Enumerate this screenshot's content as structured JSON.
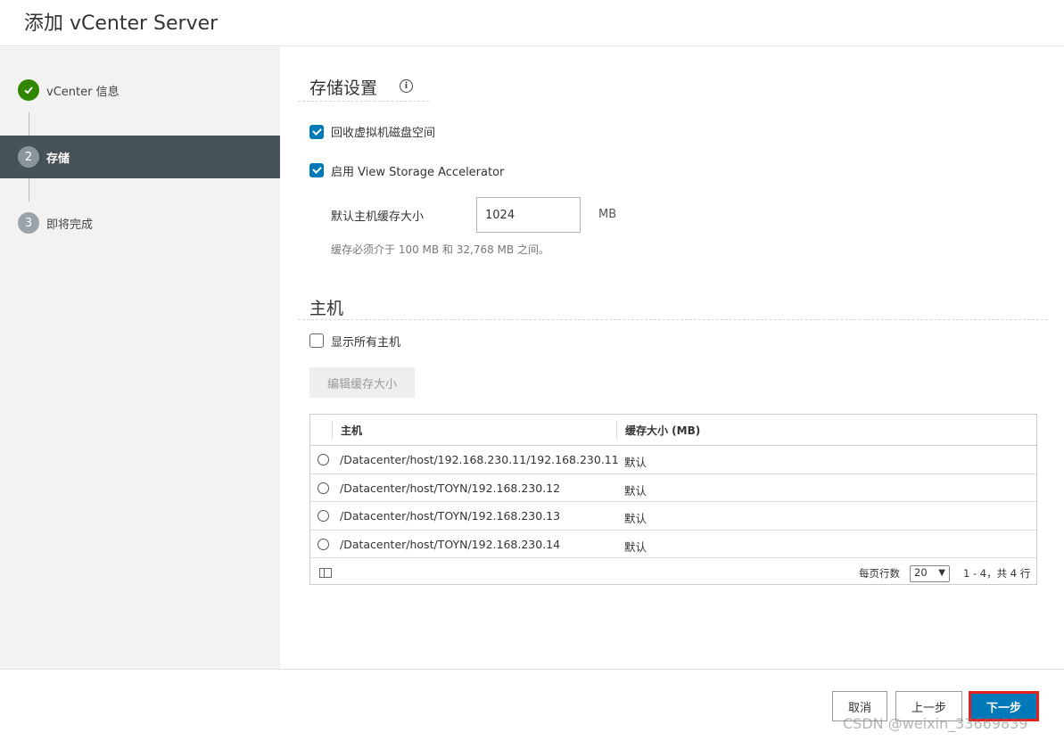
{
  "header": {
    "title": "添加 vCenter Server"
  },
  "steps": [
    {
      "number": "",
      "label": "vCenter 信息",
      "state": "done"
    },
    {
      "number": "2",
      "label": "存储",
      "state": "active"
    },
    {
      "number": "3",
      "label": "即将完成",
      "state": "pending"
    }
  ],
  "storage": {
    "title": "存储设置",
    "info_icon": "ⓘ",
    "reclaim_label": "回收虚拟机磁盘空间",
    "reclaim_checked": true,
    "vsa_label": "启用 View Storage Accelerator",
    "vsa_checked": true,
    "cache_label": "默认主机缓存大小",
    "cache_value": "1024",
    "cache_unit": "MB",
    "cache_hint": "缓存必须介于 100 MB 和 32,768 MB 之间。"
  },
  "hosts": {
    "title": "主机",
    "show_all_label": "显示所有主机",
    "show_all_checked": false,
    "edit_button": "编辑缓存大小",
    "columns": [
      "主机",
      "缓存大小 (MB)"
    ],
    "rows": [
      {
        "host": "/Datacenter/host/192.168.230.11/192.168.230.11",
        "cache": "默认"
      },
      {
        "host": "/Datacenter/host/TOYN/192.168.230.12",
        "cache": "默认"
      },
      {
        "host": "/Datacenter/host/TOYN/192.168.230.13",
        "cache": "默认"
      },
      {
        "host": "/Datacenter/host/TOYN/192.168.230.14",
        "cache": "默认"
      }
    ],
    "page_size_label": "每页行数",
    "page_size": "20",
    "pagination": "1 - 4，共 4 行"
  },
  "footer": {
    "cancel": "取消",
    "back": "上一步",
    "next": "下一步"
  },
  "watermark": "CSDN @weixin_33669839",
  "colors": {
    "accent": "#0079b8",
    "done": "#318700",
    "active_step_bg": "#475158",
    "highlight": "#e52020"
  }
}
